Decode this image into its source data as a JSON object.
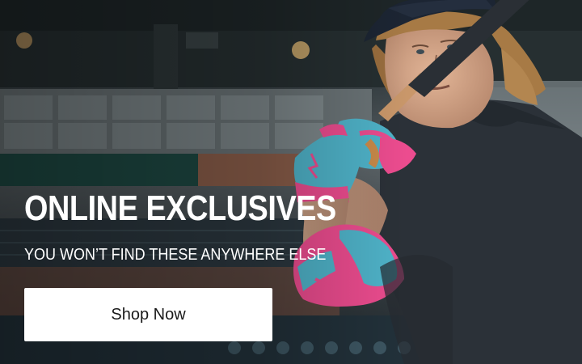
{
  "banner": {
    "headline": "ONLINE EXCLUSIVES",
    "subheadline": "YOU WON’T FIND THESE ANYWHERE ELSE",
    "cta_label": "Shop Now"
  },
  "colors": {
    "text": "#ffffff",
    "button_background": "#ffffff",
    "button_text": "#1a1a1a",
    "glove_accent_blue": "#4fb3c9",
    "glove_accent_pink": "#ec4c8f",
    "shirt": "#2b3138"
  }
}
